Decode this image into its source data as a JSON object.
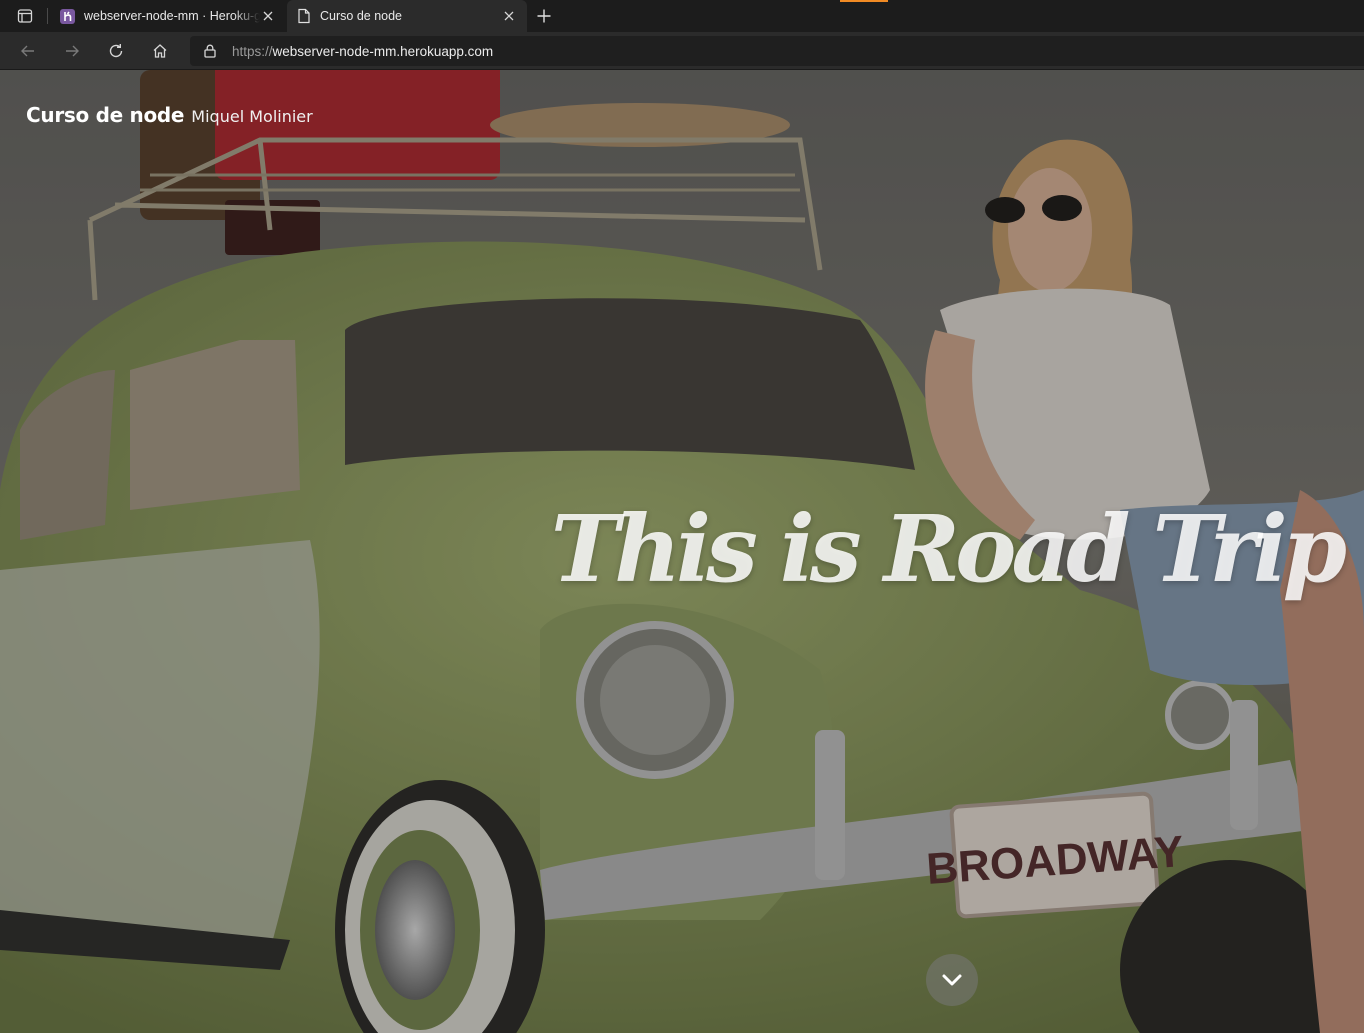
{
  "browser": {
    "tabs": [
      {
        "title": "webserver-node-mm · Heroku-git",
        "favicon": "heroku-icon",
        "active": false
      },
      {
        "title": "Curso de node",
        "favicon": "page-icon",
        "active": true
      }
    ],
    "address": {
      "scheme": "https://",
      "host": "webserver-node-mm.herokuapp.com"
    },
    "colors": {
      "tab_bar": "#1c1c1c",
      "toolbar": "#2b2b2b",
      "loading": "#f08a24",
      "heroku": "#79589f"
    }
  },
  "page": {
    "brand_title": "Curso de node",
    "brand_subtitle": "Miquel Molinier",
    "hero_heading": "This is Road Trip",
    "license_plate": "BROADWAY",
    "scroll_icon": "chevron-down-icon"
  }
}
